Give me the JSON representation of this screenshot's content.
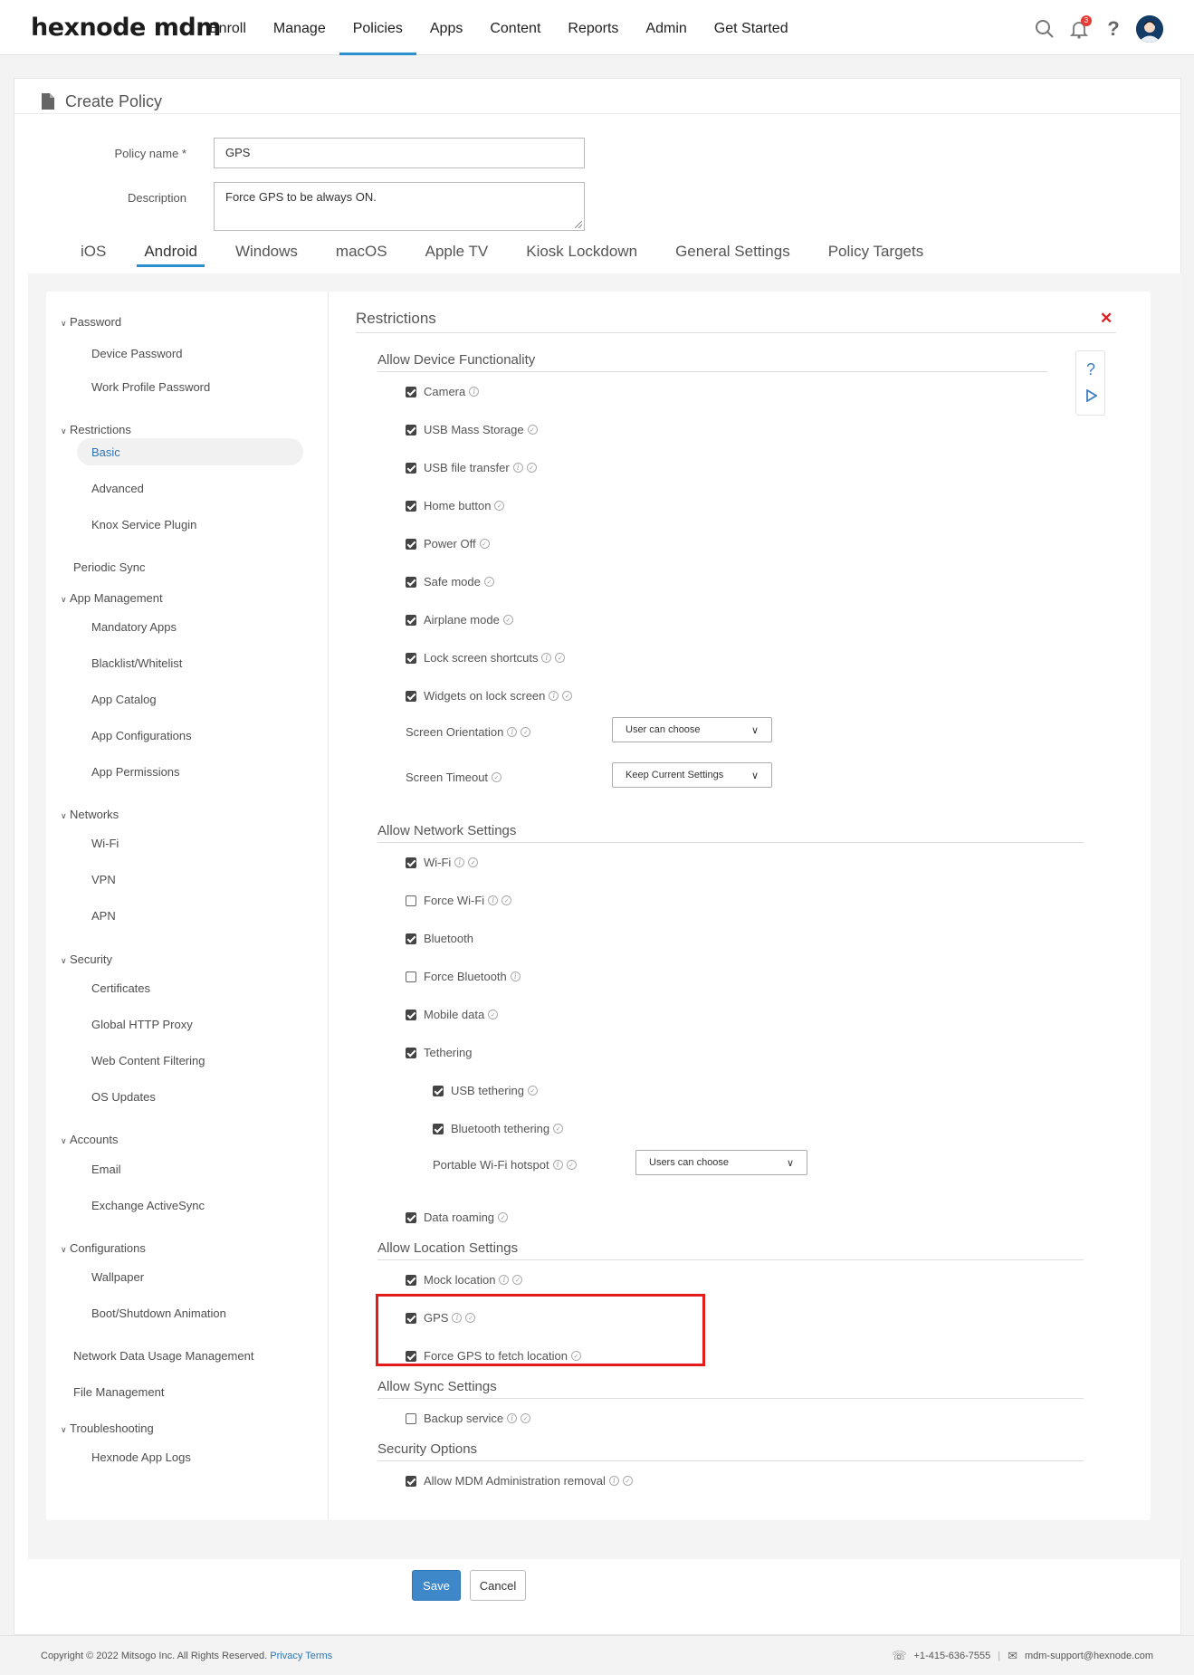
{
  "brand": {
    "name": "hexnode mdm"
  },
  "nav": {
    "items": [
      "Enroll",
      "Manage",
      "Policies",
      "Apps",
      "Content",
      "Reports",
      "Admin",
      "Get Started"
    ],
    "active": "Policies"
  },
  "header": {
    "notification_count": "3"
  },
  "page": {
    "title": "Create Policy"
  },
  "form": {
    "policy_name_label": "Policy name *",
    "policy_name_value": "GPS",
    "description_label": "Description",
    "description_value": "Force GPS to be always ON."
  },
  "os_tabs": [
    "iOS",
    "Android",
    "Windows",
    "macOS",
    "Apple TV",
    "Kiosk Lockdown",
    "General Settings",
    "Policy Targets"
  ],
  "sidebar": {
    "password": "Password",
    "device_password": "Device Password",
    "work_profile_password": "Work Profile Password",
    "restrictions": "Restrictions",
    "basic": "Basic",
    "advanced": "Advanced",
    "knox": "Knox Service Plugin",
    "periodic_sync": "Periodic Sync",
    "app_management": "App Management",
    "mandatory_apps": "Mandatory Apps",
    "blacklist": "Blacklist/Whitelist",
    "app_catalog": "App Catalog",
    "app_configurations": "App Configurations",
    "app_permissions": "App Permissions",
    "networks": "Networks",
    "wifi": "Wi-Fi",
    "vpn": "VPN",
    "apn": "APN",
    "security": "Security",
    "certificates": "Certificates",
    "http_proxy": "Global HTTP Proxy",
    "web_content": "Web Content Filtering",
    "os_updates": "OS Updates",
    "accounts": "Accounts",
    "email": "Email",
    "exchange": "Exchange ActiveSync",
    "configurations": "Configurations",
    "wallpaper": "Wallpaper",
    "boot_animation": "Boot/Shutdown Animation",
    "network_data": "Network Data Usage Management",
    "file_management": "File Management",
    "troubleshooting": "Troubleshooting",
    "app_logs": "Hexnode App Logs"
  },
  "content": {
    "section_title": "Restrictions",
    "device_group": "Allow Device Functionality",
    "device_items": [
      {
        "label": "Camera",
        "checked": true
      },
      {
        "label": "USB Mass Storage",
        "checked": true
      },
      {
        "label": "USB file transfer",
        "checked": true
      },
      {
        "label": "Home button",
        "checked": true
      },
      {
        "label": "Power Off",
        "checked": true
      },
      {
        "label": "Safe mode",
        "checked": true
      },
      {
        "label": "Airplane mode",
        "checked": true
      },
      {
        "label": "Lock screen shortcuts",
        "checked": true
      },
      {
        "label": "Widgets on lock screen",
        "checked": true
      }
    ],
    "screen_orientation_label": "Screen Orientation",
    "screen_orientation_value": "User can choose",
    "screen_timeout_label": "Screen Timeout",
    "screen_timeout_value": "Keep Current Settings",
    "network_group": "Allow Network Settings",
    "network_items": [
      {
        "label": "Wi-Fi",
        "checked": true
      },
      {
        "label": "Force Wi-Fi",
        "checked": false
      },
      {
        "label": "Bluetooth",
        "checked": true
      },
      {
        "label": "Force Bluetooth",
        "checked": false
      },
      {
        "label": "Mobile data",
        "checked": true
      },
      {
        "label": "Tethering",
        "checked": true
      }
    ],
    "tether_items": [
      {
        "label": "USB tethering",
        "checked": true
      },
      {
        "label": "Bluetooth tethering",
        "checked": true
      }
    ],
    "hotspot_label": "Portable Wi-Fi hotspot",
    "hotspot_value": "Users can choose",
    "data_roaming": "Data roaming",
    "location_group": "Allow Location Settings",
    "mock_location": "Mock location",
    "gps": "GPS",
    "force_gps": "Force GPS to fetch location",
    "sync_group": "Allow Sync Settings",
    "backup_service": "Backup service",
    "security_group": "Security Options",
    "mdm_removal": "Allow MDM Administration removal"
  },
  "actions": {
    "save": "Save",
    "cancel": "Cancel"
  },
  "footer": {
    "copyright": "Copyright © 2022 Mitsogo Inc. All Rights Reserved.",
    "privacy": "Privacy",
    "terms": "Terms",
    "phone": "+1-415-636-7555",
    "email": "mdm-support@hexnode.com"
  },
  "colors": {
    "accent": "#2b8fd0",
    "save_button": "#3e87c9",
    "highlight": "#e31b1b",
    "close": "#e02020"
  }
}
